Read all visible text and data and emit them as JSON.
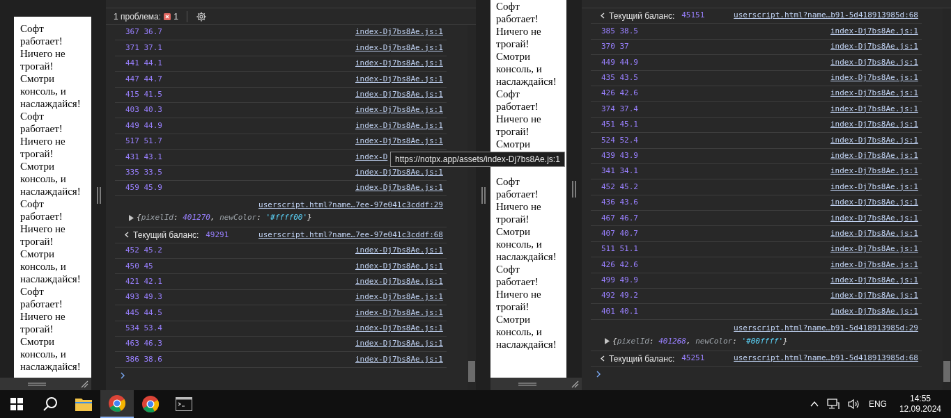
{
  "left_page": {
    "paragraphs": [
      "Софт работает! Ничего не трогай! Смотри консоль, и наслаждайся!",
      "Софт работает! Ничего не трогай! Смотри консоль, и наслаждайся!",
      "Софт работает! Ничего не трогай! Смотри консоль, и наслаждайся!",
      "Софт работает! Ничего не трогай! Смотри консоль, и наслаждайся!"
    ]
  },
  "left_console": {
    "issues": {
      "label": "1 проблема:",
      "count": "1"
    },
    "entries": [
      {
        "kind": "number",
        "text": "367 36.7",
        "source": "index-Dj7bs8Ae.js:1"
      },
      {
        "kind": "number",
        "text": "371 37.1",
        "source": "index-Dj7bs8Ae.js:1"
      },
      {
        "kind": "number",
        "text": "441 44.1",
        "source": "index-Dj7bs8Ae.js:1"
      },
      {
        "kind": "number",
        "text": "447 44.7",
        "source": "index-Dj7bs8Ae.js:1"
      },
      {
        "kind": "number",
        "text": "415 41.5",
        "source": "index-Dj7bs8Ae.js:1"
      },
      {
        "kind": "number",
        "text": "403 40.3",
        "source": "index-Dj7bs8Ae.js:1"
      },
      {
        "kind": "number",
        "text": "449 44.9",
        "source": "index-Dj7bs8Ae.js:1"
      },
      {
        "kind": "number",
        "text": "517 51.7",
        "source": "index-Dj7bs8Ae.js:1"
      },
      {
        "kind": "number",
        "text": "431 43.1",
        "source": "index-D"
      },
      {
        "kind": "number",
        "text": "335 33.5",
        "source": "index-Dj7bs8Ae.js:1"
      },
      {
        "kind": "number",
        "text": "459 45.9",
        "source": "index-Dj7bs8Ae.js:1"
      },
      {
        "kind": "object",
        "source": "userscript.html?name…7ee-97e041c3cddf:29",
        "parts": [
          {
            "kind": "punct",
            "text": "{"
          },
          {
            "kind": "key",
            "text": "pixelId"
          },
          {
            "kind": "punct",
            "text": ": "
          },
          {
            "kind": "number",
            "text": "401270"
          },
          {
            "kind": "punct",
            "text": ", "
          },
          {
            "kind": "key",
            "text": "newColor"
          },
          {
            "kind": "punct",
            "text": ": "
          },
          {
            "kind": "string",
            "text": "'#ffff00'"
          },
          {
            "kind": "punct",
            "text": "}"
          }
        ]
      },
      {
        "kind": "balance",
        "label": "Текущий баланс:",
        "value": "49291",
        "source": "userscript.html?name…7ee-97e041c3cddf:68"
      },
      {
        "kind": "number",
        "text": "452 45.2",
        "source": "index-Dj7bs8Ae.js:1"
      },
      {
        "kind": "number",
        "text": "450 45",
        "source": "index-Dj7bs8Ae.js:1"
      },
      {
        "kind": "number",
        "text": "421 42.1",
        "source": "index-Dj7bs8Ae.js:1"
      },
      {
        "kind": "number",
        "text": "493 49.3",
        "source": "index-Dj7bs8Ae.js:1"
      },
      {
        "kind": "number",
        "text": "445 44.5",
        "source": "index-Dj7bs8Ae.js:1"
      },
      {
        "kind": "number",
        "text": "534 53.4",
        "source": "index-Dj7bs8Ae.js:1"
      },
      {
        "kind": "number",
        "text": "463 46.3",
        "source": "index-Dj7bs8Ae.js:1"
      },
      {
        "kind": "number",
        "text": "386 38.6",
        "source": "index-Dj7bs8Ae.js:1"
      }
    ]
  },
  "middle_page": {
    "blocks": [
      [
        "Софт работает! Ничего не трогай! Смотри консоль, и наслаждайся!",
        "Софт работает! Ничего не трогай! Смотри"
      ],
      [
        "Софт работает! Ничего не трогай! Смотри консоль, и наслаждайся!",
        "Софт работает! Ничего не трогай! Смотри консоль, и наслаждайся!"
      ]
    ]
  },
  "right_console": {
    "entries": [
      {
        "kind": "balance",
        "label": "Текущий баланс:",
        "value": "45151",
        "source": "userscript.html?name…b91-5d418913985d:68"
      },
      {
        "kind": "number",
        "text": "385 38.5",
        "source": "index-Dj7bs8Ae.js:1"
      },
      {
        "kind": "number",
        "text": "370 37",
        "source": "index-Dj7bs8Ae.js:1"
      },
      {
        "kind": "number",
        "text": "449 44.9",
        "source": "index-Dj7bs8Ae.js:1"
      },
      {
        "kind": "number",
        "text": "435 43.5",
        "source": "index-Dj7bs8Ae.js:1"
      },
      {
        "kind": "number",
        "text": "426 42.6",
        "source": "index-Dj7bs8Ae.js:1"
      },
      {
        "kind": "number",
        "text": "374 37.4",
        "source": "index-Dj7bs8Ae.js:1"
      },
      {
        "kind": "number",
        "text": "451 45.1",
        "source": "index-Dj7bs8Ae.js:1"
      },
      {
        "kind": "number",
        "text": "524 52.4",
        "source": "index-Dj7bs8Ae.js:1"
      },
      {
        "kind": "number",
        "text": "439 43.9",
        "source": "index-Dj7bs8Ae.js:1"
      },
      {
        "kind": "number",
        "text": "341 34.1",
        "source": "index-Dj7bs8Ae.js:1"
      },
      {
        "kind": "number",
        "text": "452 45.2",
        "source": "index-Dj7bs8Ae.js:1"
      },
      {
        "kind": "number",
        "text": "436 43.6",
        "source": "index-Dj7bs8Ae.js:1"
      },
      {
        "kind": "number",
        "text": "467 46.7",
        "source": "index-Dj7bs8Ae.js:1"
      },
      {
        "kind": "number",
        "text": "407 40.7",
        "source": "index-Dj7bs8Ae.js:1"
      },
      {
        "kind": "number",
        "text": "511 51.1",
        "source": "index-Dj7bs8Ae.js:1"
      },
      {
        "kind": "number",
        "text": "426 42.6",
        "source": "index-Dj7bs8Ae.js:1"
      },
      {
        "kind": "number",
        "text": "499 49.9",
        "source": "index-Dj7bs8Ae.js:1"
      },
      {
        "kind": "number",
        "text": "492 49.2",
        "source": "index-Dj7bs8Ae.js:1"
      },
      {
        "kind": "number",
        "text": "401 40.1",
        "source": "index-Dj7bs8Ae.js:1"
      },
      {
        "kind": "object",
        "source": "userscript.html?name…b91-5d418913985d:29",
        "parts": [
          {
            "kind": "punct",
            "text": "{"
          },
          {
            "kind": "key",
            "text": "pixelId"
          },
          {
            "kind": "punct",
            "text": ": "
          },
          {
            "kind": "number",
            "text": "401268"
          },
          {
            "kind": "punct",
            "text": ", "
          },
          {
            "kind": "key",
            "text": "newColor"
          },
          {
            "kind": "punct",
            "text": ": "
          },
          {
            "kind": "string",
            "text": "'#00ffff'"
          },
          {
            "kind": "punct",
            "text": "}"
          }
        ]
      },
      {
        "kind": "balance",
        "label": "Текущий баланс:",
        "value": "45251",
        "source": "userscript.html?name…b91-5d418913985d:68"
      }
    ]
  },
  "tooltip": {
    "text": "https://notpx.app/assets/index-Dj7bs8Ae.js:1"
  },
  "taskbar": {
    "language": "ENG",
    "time": "14:55",
    "date": "12.09.2024"
  }
}
